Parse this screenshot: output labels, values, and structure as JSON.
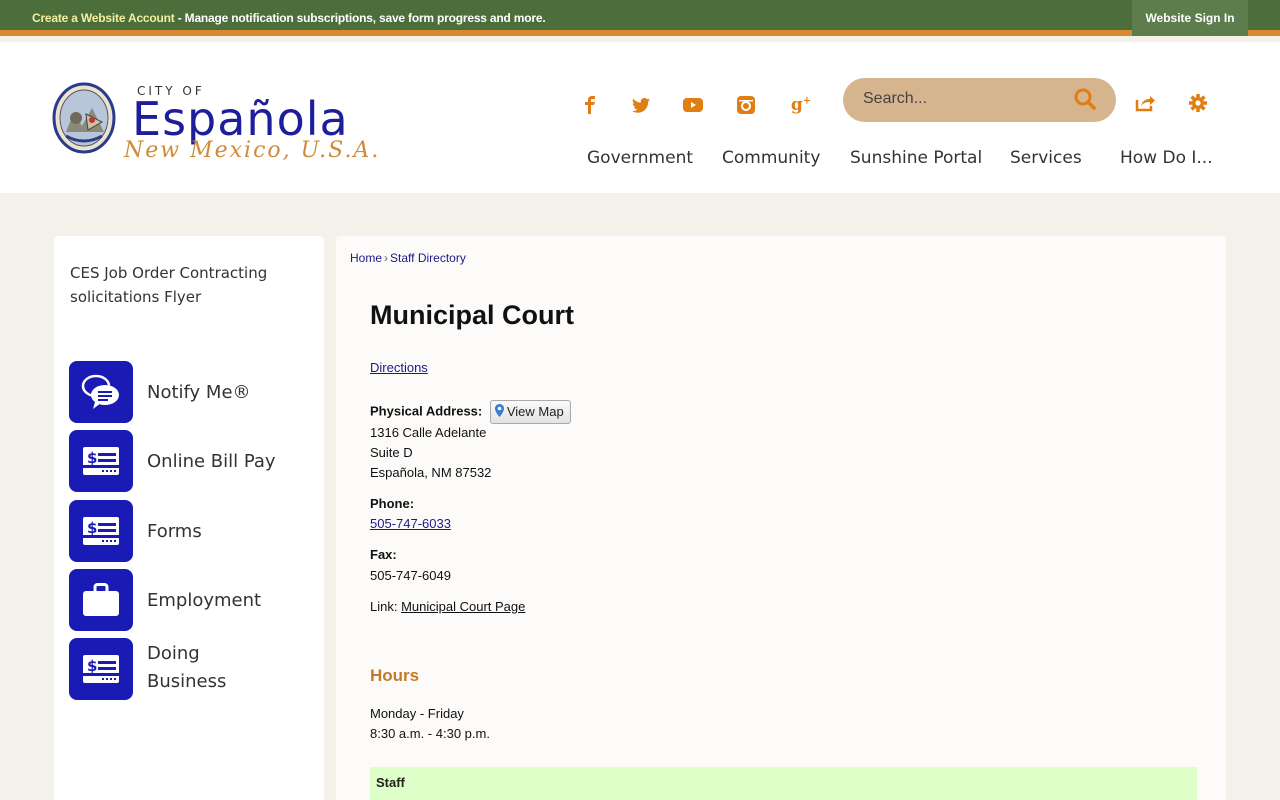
{
  "topbar": {
    "account_link": "Create a Website Account",
    "account_text": " - Manage notification subscriptions, save form progress and more.",
    "signin": "Website Sign In"
  },
  "logo": {
    "city_of": "CITY OF",
    "name": "Española",
    "state": "New Mexico, U.S.A."
  },
  "social": [
    "facebook-icon",
    "twitter-icon",
    "youtube-icon",
    "instagram-icon",
    "google-plus-icon"
  ],
  "search": {
    "placeholder": "Search..."
  },
  "nav": [
    "Government",
    "Community",
    "Sunshine Portal",
    "Services",
    "How Do I..."
  ],
  "sidebar": {
    "flyer": "CES Job Order Contracting solicitations Flyer",
    "quicklinks": [
      {
        "label": "Notify Me®",
        "icon": "chat-bubbles-icon"
      },
      {
        "label": "Online Bill Pay",
        "icon": "bill-icon"
      },
      {
        "label": "Forms",
        "icon": "bill-icon"
      },
      {
        "label": "Employment",
        "icon": "briefcase-icon"
      },
      {
        "label": "Doing Business",
        "icon": "bill-icon"
      }
    ]
  },
  "breadcrumb": {
    "home": "Home",
    "sep": "›",
    "current": "Staff Directory"
  },
  "dept": {
    "title": "Municipal Court",
    "directions": "Directions",
    "address_label": "Physical Address:",
    "view_map": "View Map",
    "address1": "1316 Calle Adelante",
    "address2": "Suite D",
    "address3": "Española, NM 87532",
    "phone_label": "Phone:",
    "phone": "505-747-6033",
    "fax_label": "Fax:",
    "fax": "505-747-6049",
    "link_label": "Link: ",
    "link": "Municipal Court Page",
    "hours_heading": "Hours",
    "hours_days": "Monday - Friday",
    "hours_time": "8:30 a.m. - 4:30 p.m.",
    "staff_header": "Staff"
  },
  "colors": {
    "topbar": "#4b6e3a",
    "accent_orange": "#e07e12",
    "brand_blue": "#1a1ab5",
    "staff_row": "#dfffc8"
  }
}
